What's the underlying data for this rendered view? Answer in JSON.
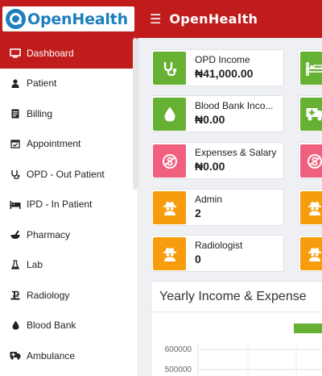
{
  "brand": {
    "logo_text": "OpenHealth",
    "title": "OpenHealth",
    "primary_color": "#c11c1c",
    "logo_color": "#1d7fbe"
  },
  "sidebar": {
    "items": [
      {
        "label": "Dashboard",
        "icon": "monitor-icon",
        "active": true
      },
      {
        "label": "Patient",
        "icon": "user-icon"
      },
      {
        "label": "Billing",
        "icon": "invoice-icon"
      },
      {
        "label": "Appointment",
        "icon": "calendar-check-icon"
      },
      {
        "label": "OPD - Out Patient",
        "icon": "stethoscope-icon"
      },
      {
        "label": "IPD - In Patient",
        "icon": "bed-icon"
      },
      {
        "label": "Pharmacy",
        "icon": "mortar-pestle-icon"
      },
      {
        "label": "Lab",
        "icon": "flask-icon"
      },
      {
        "label": "Radiology",
        "icon": "radiation-icon"
      },
      {
        "label": "Blood Bank",
        "icon": "blood-drop-icon"
      },
      {
        "label": "Ambulance",
        "icon": "ambulance-icon"
      }
    ]
  },
  "cards": [
    {
      "label": "OPD Income",
      "value": "₦41,000.00",
      "color": "#66b033",
      "icon": "stethoscope-icon"
    },
    {
      "label": "Blood Bank Inco...",
      "value": "₦0.00",
      "color": "#66b033",
      "icon": "blood-drop-icon"
    },
    {
      "label": "Expenses & Salary",
      "value": "₦0.00",
      "color": "#f0607e",
      "icon": "money-icon"
    },
    {
      "label": "Admin",
      "value": "2",
      "color": "#f79c0d",
      "icon": "user-secret-icon"
    },
    {
      "label": "Radiologist",
      "value": "0",
      "color": "#f79c0d",
      "icon": "user-secret-icon"
    }
  ],
  "right_cards": [
    {
      "color": "#66b033",
      "icon": "bed-icon"
    },
    {
      "color": "#66b033",
      "icon": "ambulance-icon"
    },
    {
      "color": "#f0607e",
      "icon": "money-icon"
    },
    {
      "color": "#f79c0d",
      "icon": "user-secret-icon"
    },
    {
      "color": "#f79c0d",
      "icon": "user-secret-icon"
    }
  ],
  "chart_panel": {
    "title": "Yearly Income & Expense",
    "chart_data": {
      "type": "bar",
      "ytick_labels": [
        "600000",
        "500000"
      ],
      "series_color": "#66b033",
      "grid": true
    }
  }
}
